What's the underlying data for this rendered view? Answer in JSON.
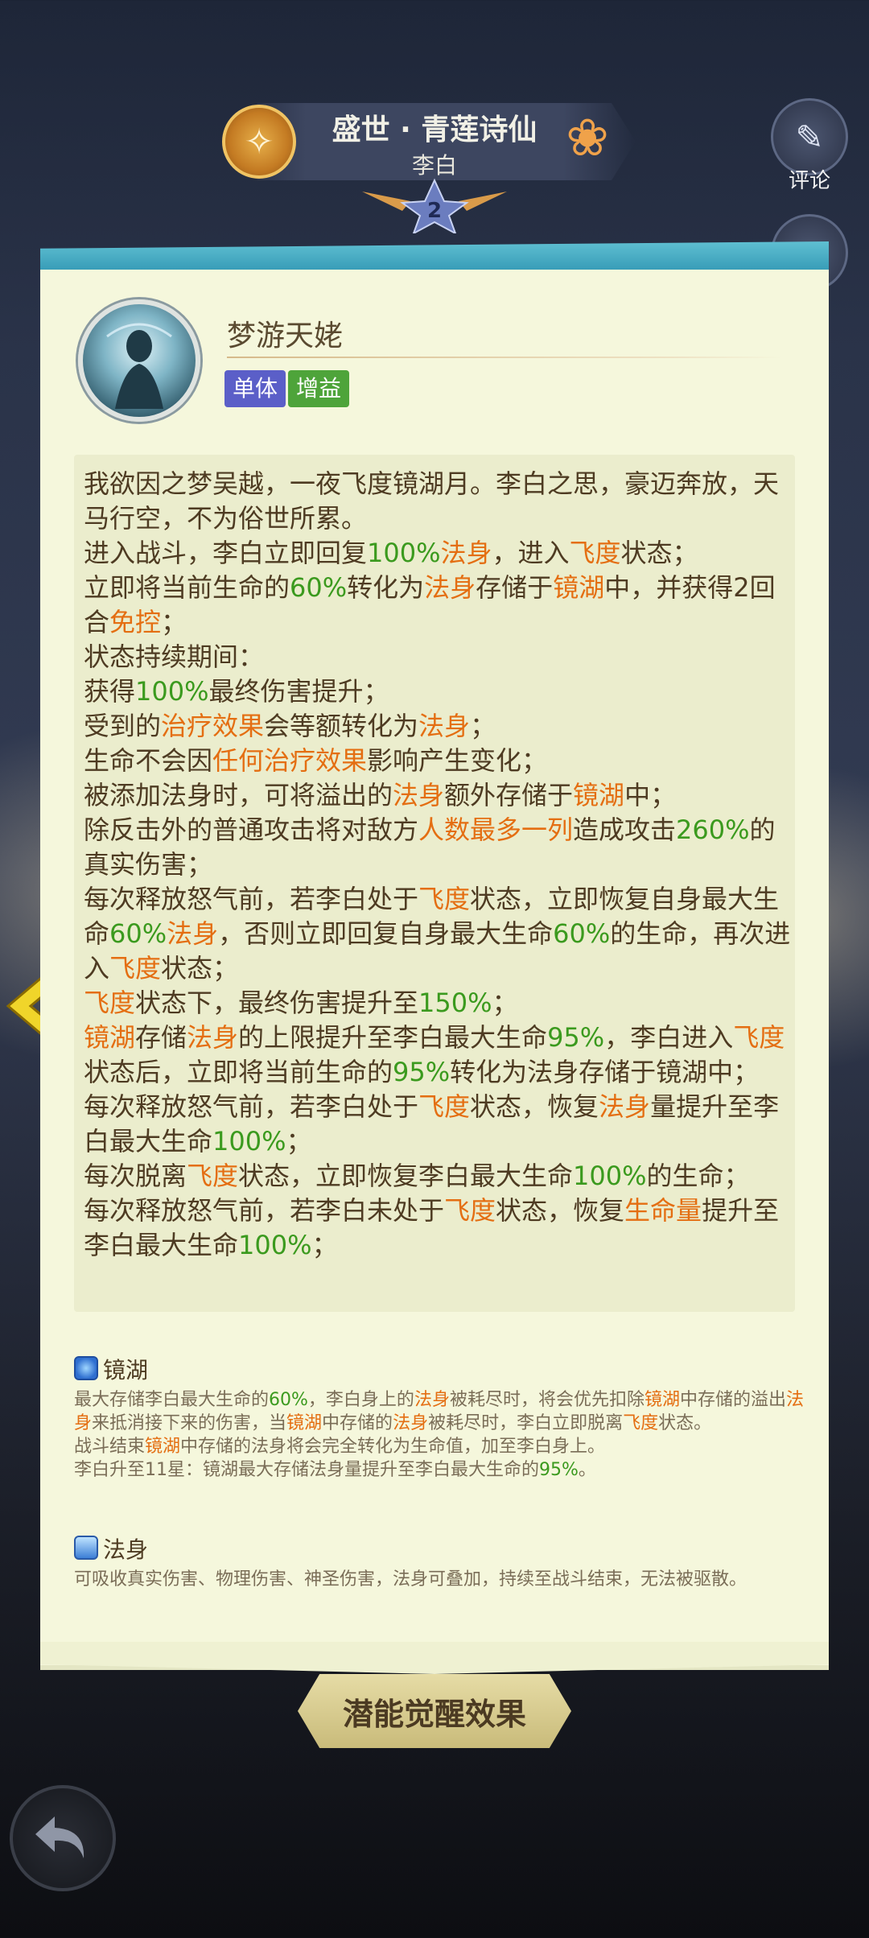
{
  "header": {
    "title": "盛世 · 青莲诗仙",
    "hero_name": "李白",
    "star_level": "2"
  },
  "side_buttons": {
    "comment_label": "评论"
  },
  "skill": {
    "name": "梦游天姥",
    "tags": [
      "单体",
      "增益"
    ],
    "description": [
      [
        [
          "t",
          "我欲因之梦吴越，一夜飞度镜湖月。李白之思，豪迈奔放，天马行空，不为俗世所累。"
        ]
      ],
      [
        [
          "t",
          "进入战斗，李白立即回复"
        ],
        [
          "g",
          "100%"
        ],
        [
          "o",
          "法身"
        ],
        [
          "t",
          "，进入"
        ],
        [
          "o",
          "飞度"
        ],
        [
          "t",
          "状态；"
        ]
      ],
      [
        [
          "t",
          "立即将当前生命的"
        ],
        [
          "g",
          "60%"
        ],
        [
          "t",
          "转化为"
        ],
        [
          "o",
          "法身"
        ],
        [
          "t",
          "存储于"
        ],
        [
          "o",
          "镜湖"
        ],
        [
          "t",
          "中，并获得2回合"
        ],
        [
          "o",
          "免控"
        ],
        [
          "t",
          "；"
        ]
      ],
      [
        [
          "t",
          "状态持续期间："
        ]
      ],
      [
        [
          "t",
          "获得"
        ],
        [
          "g",
          "100%"
        ],
        [
          "t",
          "最终伤害提升；"
        ]
      ],
      [
        [
          "t",
          "受到的"
        ],
        [
          "o",
          "治疗效果"
        ],
        [
          "t",
          "会等额转化为"
        ],
        [
          "o",
          "法身"
        ],
        [
          "t",
          "；"
        ]
      ],
      [
        [
          "t",
          "生命不会因"
        ],
        [
          "o",
          "任何治疗效果"
        ],
        [
          "t",
          "影响产生变化；"
        ]
      ],
      [
        [
          "t",
          "被添加法身时，可将溢出的"
        ],
        [
          "o",
          "法身"
        ],
        [
          "t",
          "额外存储于"
        ],
        [
          "o",
          "镜湖"
        ],
        [
          "t",
          "中；"
        ]
      ],
      [
        [
          "t",
          "除反击外的普通攻击将对敌方"
        ],
        [
          "o",
          "人数最多一列"
        ],
        [
          "t",
          "造成攻击"
        ],
        [
          "g",
          "260%"
        ],
        [
          "t",
          "的真实伤害；"
        ]
      ],
      [
        [
          "t",
          "每次释放怒气前，若李白处于"
        ],
        [
          "o",
          "飞度"
        ],
        [
          "t",
          "状态，立即恢复自身最大生命"
        ],
        [
          "g",
          "60%"
        ],
        [
          "o",
          "法身"
        ],
        [
          "t",
          "，否则立即回复自身最大生命"
        ],
        [
          "g",
          "60%"
        ],
        [
          "t",
          "的生命，再次进入"
        ],
        [
          "o",
          "飞度"
        ],
        [
          "t",
          "状态；"
        ]
      ],
      [
        [
          "o",
          "飞度"
        ],
        [
          "t",
          "状态下，最终伤害提升至"
        ],
        [
          "g",
          "150%"
        ],
        [
          "t",
          "；"
        ]
      ],
      [
        [
          "o",
          "镜湖"
        ],
        [
          "t",
          "存储"
        ],
        [
          "o",
          "法身"
        ],
        [
          "t",
          "的上限提升至李白最大生命"
        ],
        [
          "g",
          "95%"
        ],
        [
          "t",
          "，李白进入"
        ],
        [
          "o",
          "飞度"
        ],
        [
          "t",
          "状态后，立即将当前生命的"
        ],
        [
          "g",
          "95%"
        ],
        [
          "t",
          "转化为法身存储于镜湖中；"
        ]
      ],
      [
        [
          "t",
          "每次释放怒气前，若李白处于"
        ],
        [
          "o",
          "飞度"
        ],
        [
          "t",
          "状态，恢复"
        ],
        [
          "o",
          "法身"
        ],
        [
          "t",
          "量提升至李白最大生命"
        ],
        [
          "g",
          "100%"
        ],
        [
          "t",
          "；"
        ]
      ],
      [
        [
          "t",
          "每次脱离"
        ],
        [
          "o",
          "飞度"
        ],
        [
          "t",
          "状态，立即恢复李白最大生命"
        ],
        [
          "g",
          "100%"
        ],
        [
          "t",
          "的生命；"
        ]
      ],
      [
        [
          "t",
          "每次释放怒气前，若李白未处于"
        ],
        [
          "o",
          "飞度"
        ],
        [
          "t",
          "状态，恢复"
        ],
        [
          "o",
          "生命量"
        ],
        [
          "t",
          "提升至李白最大生命"
        ],
        [
          "g",
          "100%"
        ],
        [
          "t",
          "；"
        ]
      ]
    ]
  },
  "keywords": {
    "mirror_lake": {
      "title": "镜湖",
      "lines": [
        [
          [
            "t",
            "最大存储李白最大生命的"
          ],
          [
            "g",
            "60%"
          ],
          [
            "t",
            "，李白身上的"
          ],
          [
            "o",
            "法身"
          ],
          [
            "t",
            "被耗尽时，将会优先扣除"
          ],
          [
            "o",
            "镜湖"
          ],
          [
            "t",
            "中存储的溢出"
          ],
          [
            "o",
            "法身"
          ],
          [
            "t",
            "来抵消接下来的伤害，当"
          ],
          [
            "o",
            "镜湖"
          ],
          [
            "t",
            "中存储的"
          ],
          [
            "o",
            "法身"
          ],
          [
            "t",
            "被耗尽时，李白立即脱离"
          ],
          [
            "o",
            "飞度"
          ],
          [
            "t",
            "状态。"
          ]
        ],
        [
          [
            "t",
            "战斗结束"
          ],
          [
            "o",
            "镜湖"
          ],
          [
            "t",
            "中存储的法身将会完全转化为生命值，加至李白身上。"
          ]
        ],
        [
          [
            "t",
            "李白升至11星：镜湖最大存储法身量提升至李白最大生命的"
          ],
          [
            "g",
            "95%"
          ],
          [
            "t",
            "。"
          ]
        ]
      ]
    },
    "dharma_body": {
      "title": "法身",
      "text": "可吸收真实伤害、物理伤害、神圣伤害，法身可叠加，持续至战斗结束，无法被驱散。"
    }
  },
  "bottom": {
    "potential_button": "潜能觉醒效果"
  },
  "colors": {
    "highlight_green": "#3b9a1e",
    "highlight_orange": "#e46e12",
    "tag_single": "#5b5fc8",
    "tag_buff": "#4ea43a"
  }
}
